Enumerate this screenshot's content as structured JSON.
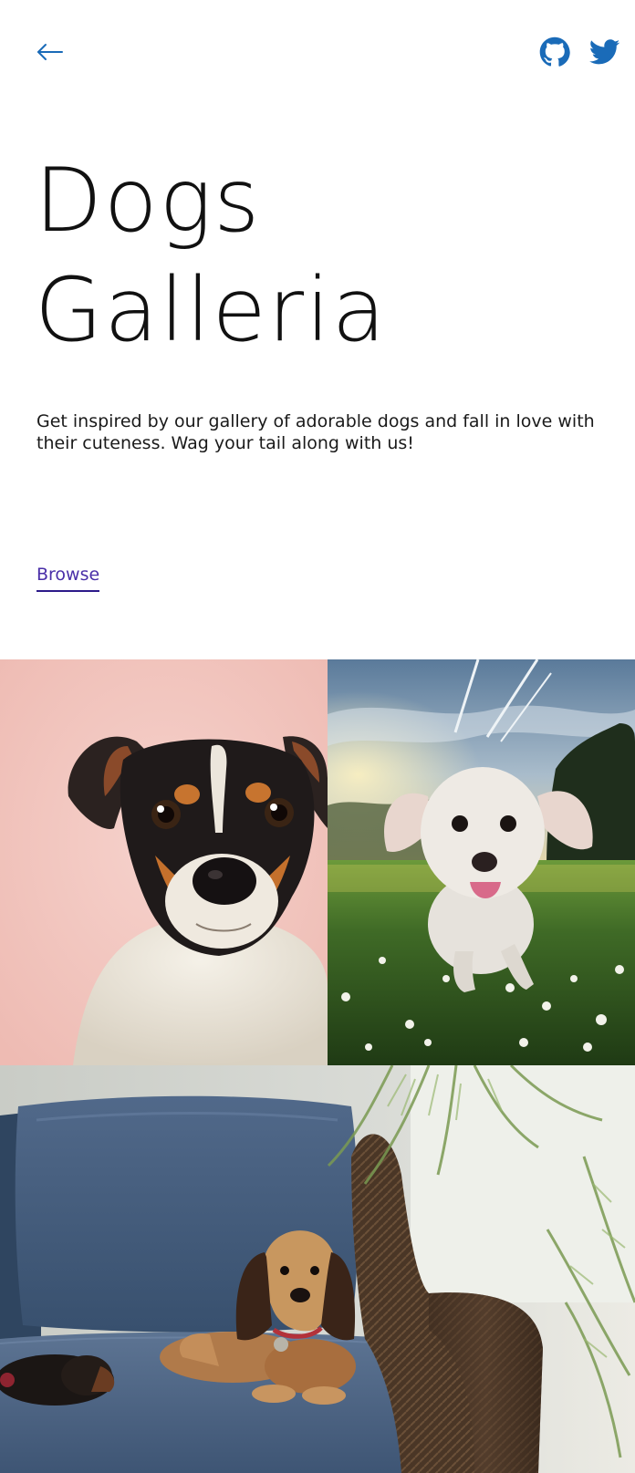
{
  "nav": {
    "back_icon": "arrow-left-icon",
    "social_icons": [
      "github-icon",
      "twitter-icon"
    ]
  },
  "colors": {
    "accent": "#1a6bb8",
    "link": "#4a2fa8",
    "link_underline": "#2c1a8a",
    "text": "#111111"
  },
  "hero": {
    "title_line1": "Dogs",
    "title_line2": "Galleria",
    "description": "Get inspired by our gallery of adorable dogs and fall in love with their cuteness. Wag your tail along with us!",
    "browse_label": "Browse"
  },
  "gallery": {
    "photos": [
      "dog-photo-pink",
      "dog-photo-field",
      "dog-photo-sofa"
    ]
  }
}
